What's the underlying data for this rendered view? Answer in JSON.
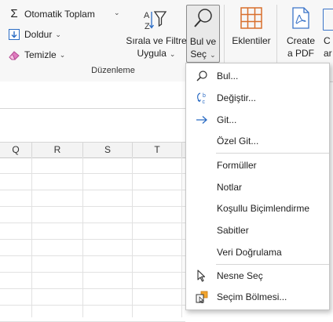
{
  "ribbon": {
    "autosum_label": "Otomatik Toplam",
    "fill_label": "Doldur",
    "clear_label": "Temizle",
    "sort_filter_line1": "Sırala ve Filtre",
    "sort_filter_line2": "Uygula",
    "find_select_line1": "Bul ve",
    "find_select_line2": "Seç",
    "addins_label": "Eklentiler",
    "create_pdf_line1": "Create",
    "create_pdf_line2": "a PDF",
    "partial_line1": "C",
    "partial_line2": "ar",
    "group_label": "Düzenleme",
    "az_text": "A",
    "za_text": "Z"
  },
  "grid": {
    "columns": [
      "Q",
      "R",
      "S",
      "T"
    ]
  },
  "menu": {
    "items": [
      {
        "label": "Bul...",
        "icon": "search-icon"
      },
      {
        "label": "Değiştir...",
        "icon": "replace-icon"
      },
      {
        "label": "Git...",
        "icon": "arrow-right-icon"
      },
      {
        "label": "Özel Git...",
        "icon": ""
      },
      {
        "label": "Formüller",
        "icon": ""
      },
      {
        "label": "Notlar",
        "icon": ""
      },
      {
        "label": "Koşullu Biçimlendirme",
        "icon": ""
      },
      {
        "label": "Sabitler",
        "icon": ""
      },
      {
        "label": "Veri Doğrulama",
        "icon": ""
      },
      {
        "label": "Nesne Seç",
        "icon": "cursor-icon"
      },
      {
        "label": "Seçim Bölmesi...",
        "icon": "selection-pane-icon"
      }
    ]
  },
  "colors": {
    "accent_blue": "#2b6cc4",
    "orange": "#d86f2c",
    "pdf_blue": "#3b74c8"
  }
}
